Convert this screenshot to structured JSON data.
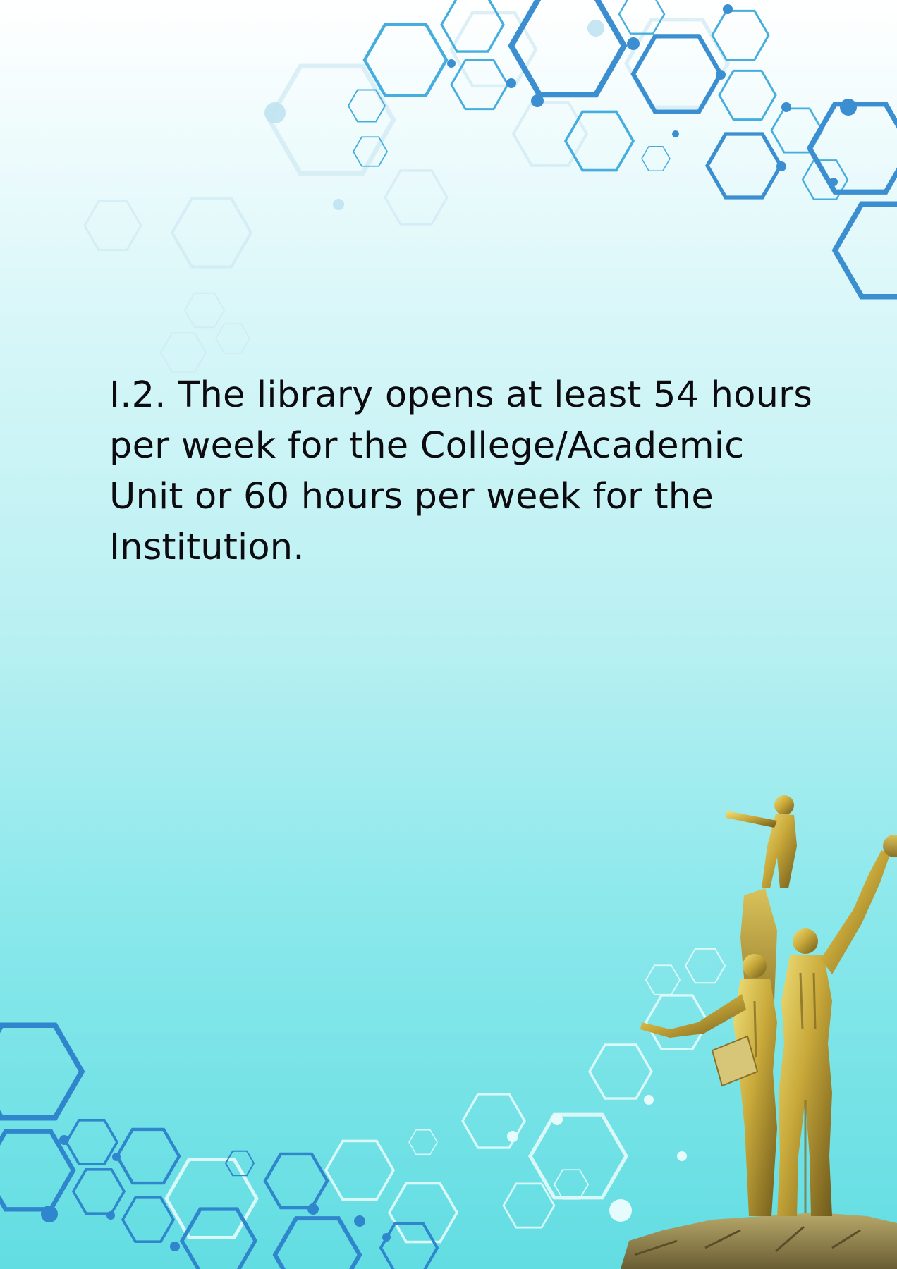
{
  "document": {
    "criterion_lines": [
      "I.2. The library opens at least 54 hours",
      "per week for the College/Academic",
      "Unit or 60 hours per week for the",
      "Institution."
    ]
  },
  "decoration": {
    "background": "light-cyan-gradient",
    "pattern": "hexagon-molecule-network",
    "illustration": "golden-statue-monument",
    "colors": {
      "hex_dark": "#2f7fc4",
      "hex_mid": "#43a8dc",
      "hex_light": "#ffffff",
      "gradient_top": "#ffffff",
      "gradient_bottom": "#62dde2",
      "statue_gold": "#c9a93a"
    }
  }
}
